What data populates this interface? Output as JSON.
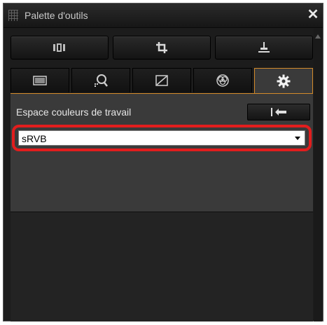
{
  "window": {
    "title": "Palette d'outils",
    "close_symbol": "✕"
  },
  "toolbar": {
    "buttons": [
      {
        "icon": "filmstrip-icon"
      },
      {
        "icon": "crop-icon"
      },
      {
        "icon": "stamp-icon"
      }
    ]
  },
  "tabs": [
    {
      "icon": "rectangle-image-icon",
      "active": false
    },
    {
      "icon": "magnifier-icon",
      "active": false
    },
    {
      "icon": "curve-icon",
      "active": false
    },
    {
      "icon": "color-circles-icon",
      "active": false
    },
    {
      "icon": "gear-icon",
      "active": true
    }
  ],
  "settings": {
    "working_color_space_label": "Espace couleurs de travail",
    "revert_icon": "revert-arrow-icon",
    "color_space_value": "sRVB"
  },
  "colors": {
    "accent_orange": "#d38a2a",
    "highlight_red": "#e21d1d"
  }
}
